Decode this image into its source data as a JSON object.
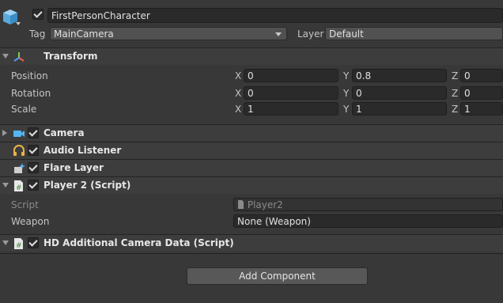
{
  "object": {
    "active": true,
    "name": "FirstPersonCharacter",
    "tag_label": "Tag",
    "tag_value": "MainCamera",
    "layer_label": "Layer",
    "layer_value": "Default"
  },
  "transform": {
    "title": "Transform",
    "rows": [
      {
        "label": "Position",
        "x": "0",
        "y": "0.8",
        "z": "0"
      },
      {
        "label": "Rotation",
        "x": "0",
        "y": "0",
        "z": "0"
      },
      {
        "label": "Scale",
        "x": "1",
        "y": "1",
        "z": "1"
      }
    ],
    "axis_x": "X",
    "axis_y": "Y",
    "axis_z": "Z"
  },
  "components": {
    "camera": "Camera",
    "audio_listener": "Audio Listener",
    "flare_layer": "Flare Layer",
    "player2": "Player 2 (Script)",
    "hd_camera": "HD Additional Camera Data (Script)"
  },
  "player2_fields": {
    "script_label": "Script",
    "script_value": "Player2",
    "weapon_label": "Weapon",
    "weapon_value": "None (Weapon)"
  },
  "add_component_label": "Add Component",
  "colors": {
    "background": "#383838",
    "header": "#3d3d3d",
    "field": "#2a2a2a"
  }
}
